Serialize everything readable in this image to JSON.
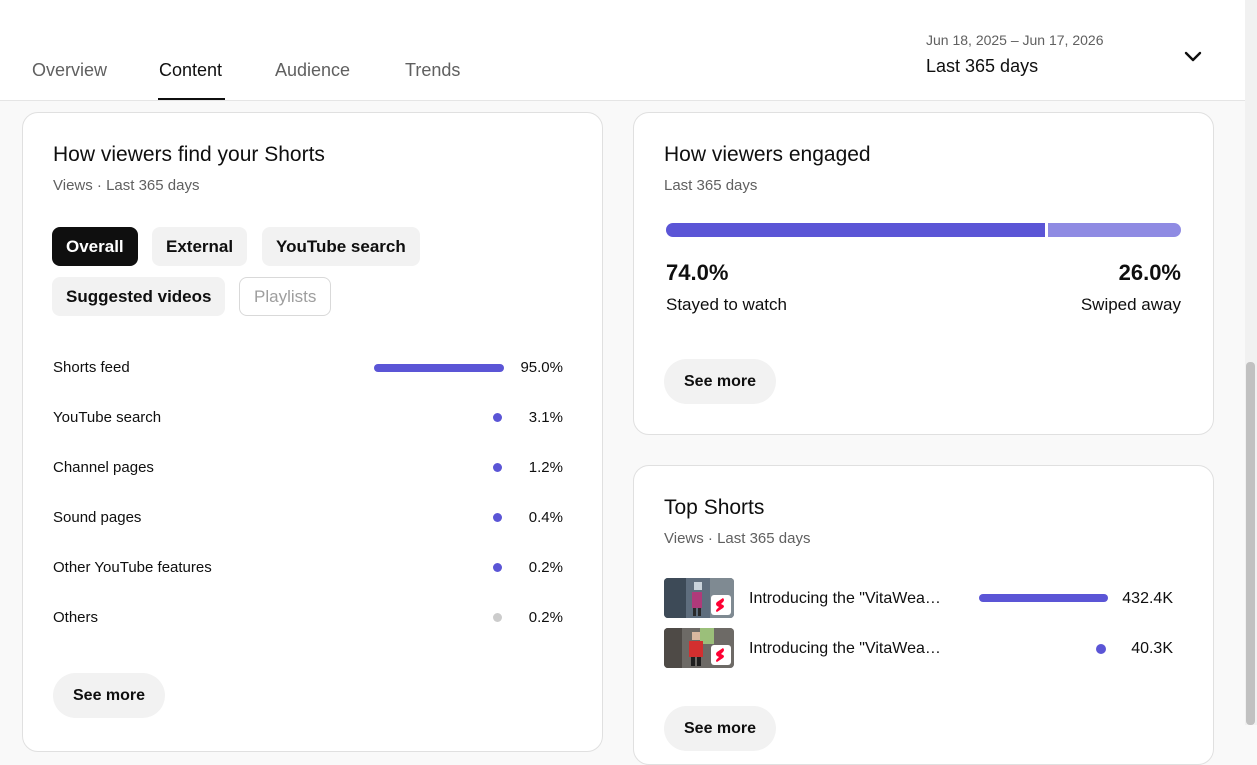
{
  "tabs": [
    {
      "label": "Overview",
      "active": false
    },
    {
      "label": "Content",
      "active": true
    },
    {
      "label": "Audience",
      "active": false
    },
    {
      "label": "Trends",
      "active": false
    }
  ],
  "date_picker": {
    "range": "Jun 18, 2025 – Jun 17, 2026",
    "period": "Last 365 days",
    "icon": "chevron-down-icon"
  },
  "find_card": {
    "title": "How viewers find your Shorts",
    "subtitle": "Views · Last 365 days",
    "chips": [
      {
        "label": "Overall",
        "state": "selected"
      },
      {
        "label": "External",
        "state": "normal"
      },
      {
        "label": "YouTube search",
        "state": "normal"
      },
      {
        "label": "Suggested videos",
        "state": "normal"
      },
      {
        "label": "Playlists",
        "state": "disabled"
      }
    ],
    "sources": [
      {
        "label": "Shorts feed",
        "value": "95.0%",
        "share": 0.95,
        "indicator": "bar"
      },
      {
        "label": "YouTube search",
        "value": "3.1%",
        "share": 0.031,
        "indicator": "dot"
      },
      {
        "label": "Channel pages",
        "value": "1.2%",
        "share": 0.012,
        "indicator": "dot"
      },
      {
        "label": "Sound pages",
        "value": "0.4%",
        "share": 0.004,
        "indicator": "dot"
      },
      {
        "label": "Other YouTube features",
        "value": "0.2%",
        "share": 0.002,
        "indicator": "dot"
      },
      {
        "label": "Others",
        "value": "0.2%",
        "share": 0.002,
        "indicator": "dot-grey"
      }
    ],
    "see_more": "See more"
  },
  "engaged_card": {
    "title": "How viewers engaged",
    "subtitle": "Last 365 days",
    "stayed": {
      "value": "74.0%",
      "label": "Stayed to watch",
      "share": 0.74
    },
    "swiped": {
      "value": "26.0%",
      "label": "Swiped away",
      "share": 0.26
    },
    "see_more": "See more"
  },
  "top_shorts_card": {
    "title": "Top Shorts",
    "subtitle": "Views · Last 365 days",
    "items": [
      {
        "title": "Introducing the \"VitaWea…",
        "views": "432.4K",
        "share": 1.0,
        "indicator": "bar"
      },
      {
        "title": "Introducing the \"VitaWea…",
        "views": "40.3K",
        "share": 0.093,
        "indicator": "dot"
      }
    ],
    "see_more": "See more"
  },
  "colors": {
    "accent": "#5b55d6",
    "accent_light": "#8f8be3",
    "dot_grey": "#cccccc",
    "shorts_red": "#ff0033"
  }
}
